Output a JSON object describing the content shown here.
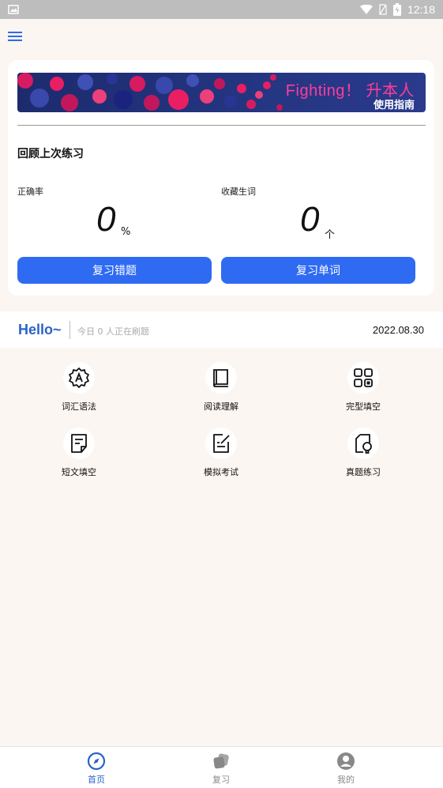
{
  "status_bar": {
    "time": "12:18"
  },
  "banner": {
    "title": "Fighting！ 升本人",
    "subtitle": "使用指南"
  },
  "review": {
    "title": "回顾上次练习",
    "accuracy_label": "正确率",
    "accuracy_value": "0",
    "accuracy_unit": "%",
    "words_label": "收藏生词",
    "words_value": "0",
    "words_unit": "个",
    "btn_mistakes": "复习错题",
    "btn_words": "复习单词"
  },
  "hello": {
    "greeting": "Hello~",
    "sub": "今日 0 人正在刷题",
    "date": "2022.08.30"
  },
  "categories": [
    {
      "label": "词汇语法",
      "icon": "vocabulary-badge-icon"
    },
    {
      "label": "阅读理解",
      "icon": "book-icon"
    },
    {
      "label": "完型填空",
      "icon": "grid-icon"
    },
    {
      "label": "短文填空",
      "icon": "document-icon"
    },
    {
      "label": "模拟考试",
      "icon": "edit-document-icon"
    },
    {
      "label": "真题练习",
      "icon": "lightbulb-icon"
    }
  ],
  "nav": [
    {
      "label": "首页",
      "icon": "compass-icon",
      "active": true
    },
    {
      "label": "复习",
      "icon": "cards-icon",
      "active": false
    },
    {
      "label": "我的",
      "icon": "profile-icon",
      "active": false
    }
  ],
  "colors": {
    "accent": "#2f6bf2",
    "nav_active": "#2a63c9",
    "nav_inactive": "#888888",
    "background": "#fbf6f1"
  }
}
